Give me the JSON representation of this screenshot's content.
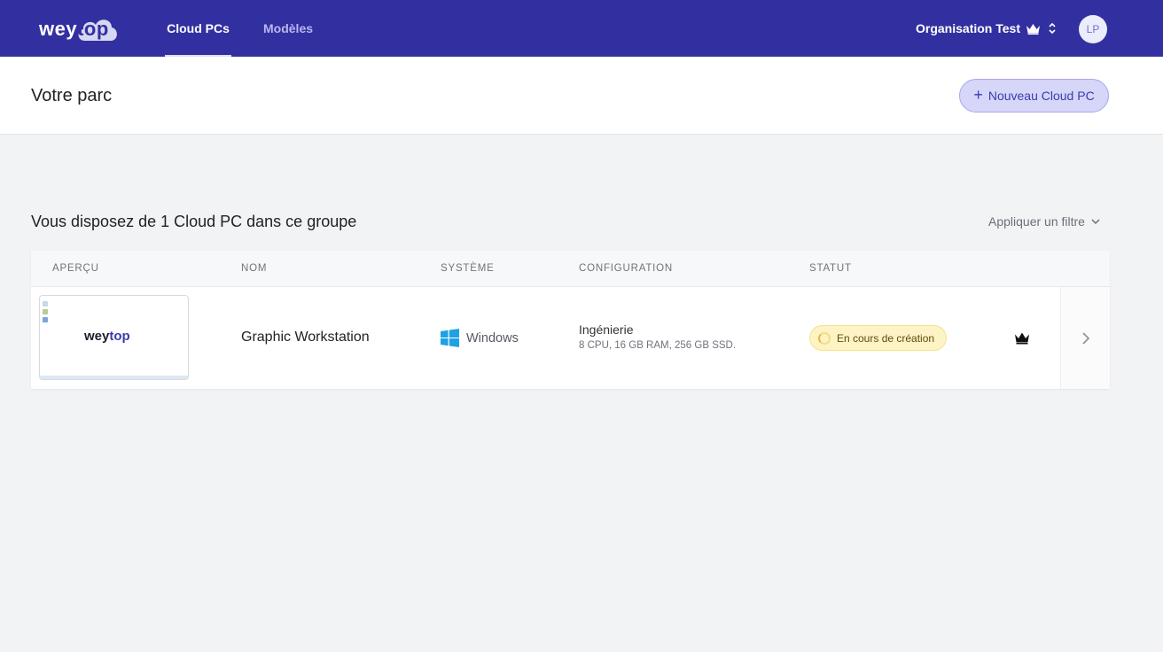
{
  "app": {
    "brand_a": "wey",
    "brand_b": "top",
    "brand_color": "#3230a0"
  },
  "nav": {
    "tabs": [
      {
        "label": "Cloud PCs",
        "active": true
      },
      {
        "label": "Modèles",
        "active": false
      }
    ],
    "org_label": "Organisation Test",
    "org_icon": "crown-icon",
    "org_switch_icon": "chevron-updown-icon",
    "avatar_initials": "LP"
  },
  "header": {
    "title": "Votre parc",
    "new_button_plus": "+",
    "new_button_label": "Nouveau Cloud PC"
  },
  "main": {
    "summary": "Vous disposez de 1 Cloud PC dans ce groupe",
    "filter_label": "Appliquer un filtre",
    "columns": [
      "APERÇU",
      "NOM",
      "SYSTÈME",
      "CONFIGURATION",
      "STATUT"
    ],
    "rows": [
      {
        "preview_brand_a": "wey",
        "preview_brand_b": "top",
        "name": "Graphic Workstation",
        "os_icon": "windows-icon",
        "os": "Windows",
        "config_name": "Ingénierie",
        "config_specs": "8 CPU, 16 GB RAM, 256 GB SSD.",
        "status": "En cours de création",
        "status_color": "#fdf3c4",
        "owner_icon": "crown-icon"
      }
    ]
  }
}
